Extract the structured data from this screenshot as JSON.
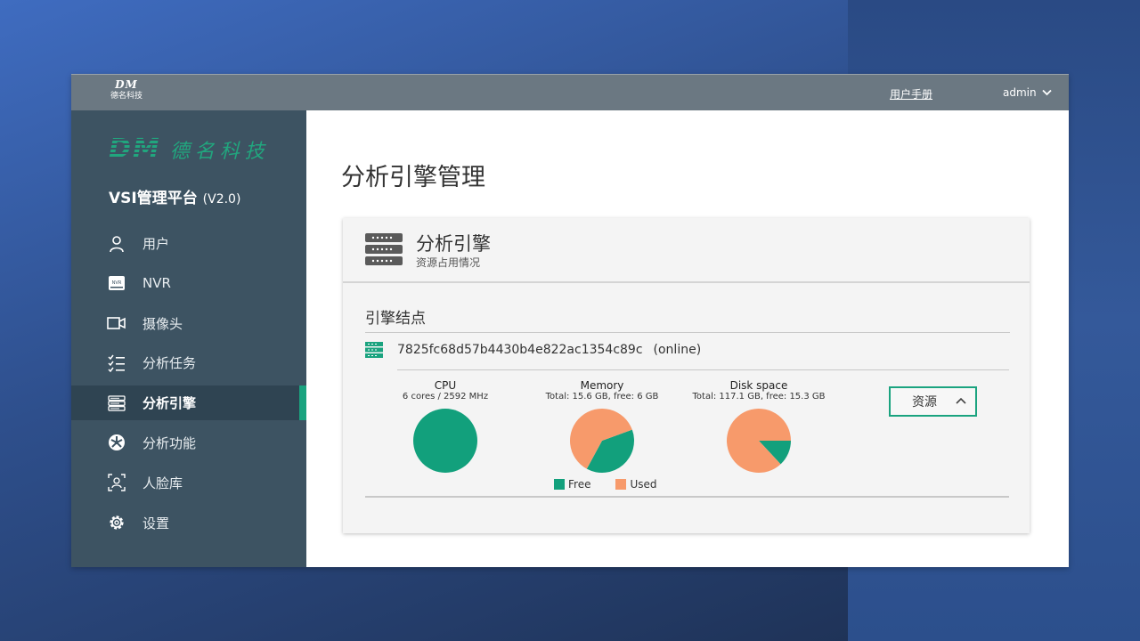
{
  "topbar": {
    "logo_mark": "DM",
    "logo_text": "德名科技",
    "manual_link": "用户手册",
    "user": "admin"
  },
  "sidebar": {
    "brand_mark": "DM",
    "brand_text": "德名科技",
    "platform_name": "VSI管理平台",
    "platform_version": "(V2.0)",
    "items": [
      {
        "label": "用户",
        "icon": "user-icon"
      },
      {
        "label": "NVR",
        "icon": "nvr-icon"
      },
      {
        "label": "摄像头",
        "icon": "camera-icon"
      },
      {
        "label": "分析任务",
        "icon": "task-list-icon"
      },
      {
        "label": "分析引擎",
        "icon": "server-icon",
        "active": true
      },
      {
        "label": "分析功能",
        "icon": "function-icon"
      },
      {
        "label": "人脸库",
        "icon": "face-scan-icon"
      },
      {
        "label": "设置",
        "icon": "gear-icon"
      }
    ]
  },
  "main": {
    "page_title": "分析引擎管理",
    "card": {
      "title": "分析引擎",
      "subtitle": "资源占用情况",
      "section_title": "引擎结点",
      "node_id": "7825fc68d57b4430b4e822ac1354c89c",
      "node_status": "(online)",
      "resource_button": "资源"
    }
  },
  "colors": {
    "accent": "#1aa37f",
    "free": "#12a07c",
    "used": "#f79a6b",
    "sidebar_bg": "#3d5362",
    "topbar_bg": "#6b7882"
  },
  "chart_data": [
    {
      "type": "pie",
      "title": "CPU",
      "subtitle": "6 cores / 2592 MHz",
      "labels": [
        "Free",
        "Used"
      ],
      "values": [
        100,
        0
      ]
    },
    {
      "type": "pie",
      "title": "Memory",
      "subtitle": "Total: 15.6 GB, free: 6 GB",
      "labels": [
        "Free",
        "Used"
      ],
      "values": [
        6,
        9.6
      ]
    },
    {
      "type": "pie",
      "title": "Disk space",
      "subtitle": "Total: 117.1 GB, free: 15.3 GB",
      "labels": [
        "Free",
        "Used"
      ],
      "values": [
        15.3,
        101.8
      ]
    }
  ],
  "legend": {
    "free": "Free",
    "used": "Used"
  }
}
